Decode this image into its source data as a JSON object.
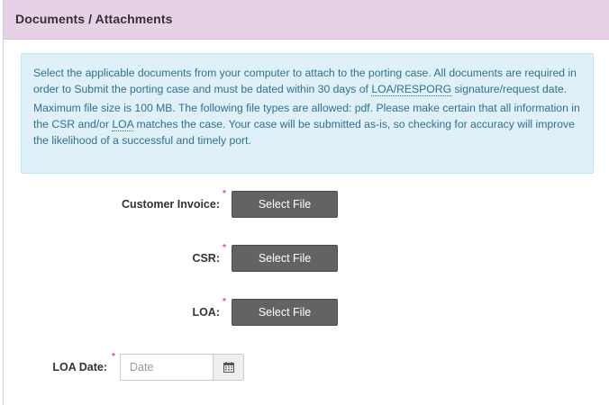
{
  "panel": {
    "title": "Documents / Attachments"
  },
  "info": {
    "p1_pre": "Select the applicable documents from your computer to attach to the porting case. All documents are required in order to Submit the porting case and must be dated within 30 days of ",
    "p1_abbr": "LOA/RESPORG",
    "p1_post": " signature/request date.",
    "p2_pre": "Maximum file size is 100 MB. The following file types are allowed: pdf. Please make certain that all information in the CSR and/or ",
    "p2_abbr": "LOA",
    "p2_post": " matches the case. Your case will be submitted as-is, so checking for accuracy will improve the likelihood of a successful and timely port."
  },
  "fields": {
    "customer_invoice": {
      "label": "Customer Invoice:",
      "required": "*",
      "button": "Select File"
    },
    "csr": {
      "label": "CSR:",
      "required": "*",
      "button": "Select File"
    },
    "loa": {
      "label": "LOA:",
      "required": "*",
      "button": "Select File"
    },
    "loa_date": {
      "label": "LOA Date:",
      "required": "*",
      "placeholder": "Date",
      "icon": "calendar-icon"
    }
  },
  "colors": {
    "header_bg": "#e6d2e6",
    "info_bg": "#dff0f8",
    "info_text": "#31708f",
    "button_bg": "#636363",
    "required": "#d9534f"
  }
}
